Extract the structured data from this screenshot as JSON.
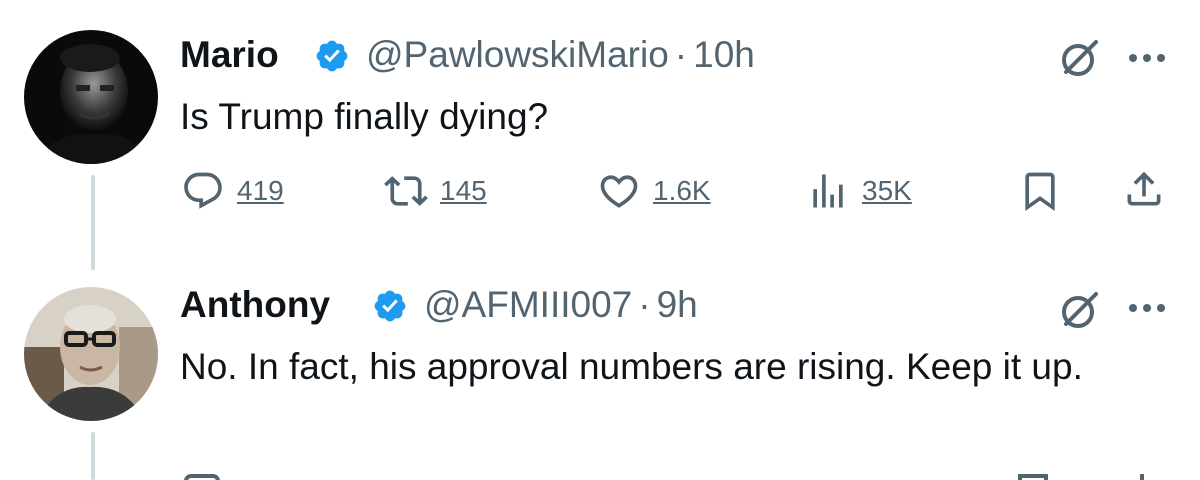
{
  "tweets": [
    {
      "name": "Mario",
      "handle": "@PawlowskiMario",
      "sep": "·",
      "time": "10h",
      "text": "Is Trump finally dying?",
      "replies": "419",
      "retweets": "145",
      "likes": "1.6K",
      "views": "35K"
    },
    {
      "name": "Anthony",
      "handle": "@AFMIII007",
      "sep": "·",
      "time": "9h",
      "text": "No. In fact, his approval numbers are rising. Keep it up."
    }
  ],
  "colors": {
    "verified": "#1d9bf0",
    "muted": "#536471",
    "thread_line": "#cfd9de"
  },
  "icons": [
    "reply-icon",
    "retweet-icon",
    "like-icon",
    "views-icon",
    "bookmark-icon",
    "share-icon",
    "grok-icon",
    "more-icon",
    "verified-badge-icon"
  ]
}
